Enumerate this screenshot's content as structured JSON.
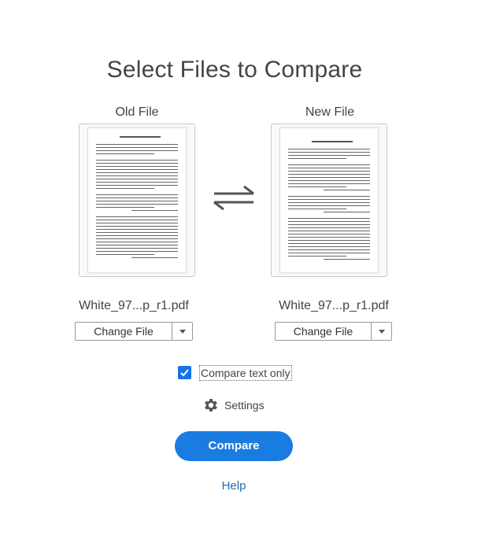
{
  "title": "Select Files to Compare",
  "old_file": {
    "label": "Old File",
    "file_name": "White_97...p_r1.pdf",
    "change_label": "Change File"
  },
  "new_file": {
    "label": "New File",
    "file_name": "White_97...p_r1.pdf",
    "change_label": "Change File"
  },
  "compare_text_only": {
    "label": "Compare text only",
    "checked": true
  },
  "settings": {
    "label": "Settings",
    "icon": "gear-icon"
  },
  "compare_button": {
    "label": "Compare"
  },
  "help": {
    "label": "Help"
  },
  "colors": {
    "accent": "#1a7be0",
    "checkbox": "#1473e6",
    "link": "#1f6db3"
  }
}
